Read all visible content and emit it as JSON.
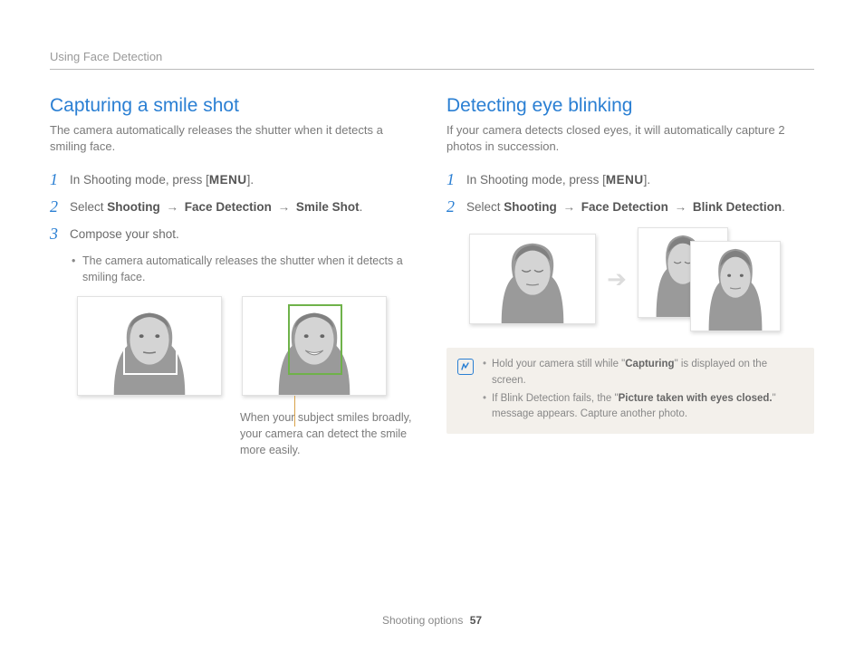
{
  "breadcrumb": "Using Face Detection",
  "left": {
    "title": "Capturing a smile shot",
    "intro": "The camera automatically releases the shutter when it detects a smiling face.",
    "steps": {
      "s1_pre": "In Shooting mode, press [",
      "s1_menu": "MENU",
      "s1_post": "].",
      "s2_pre": "Select ",
      "s2_a": "Shooting",
      "s2_b": "Face Detection",
      "s2_c": "Smile Shot",
      "s3": "Compose your shot."
    },
    "sub_bullet": "The camera automatically releases the shutter when it detects a smiling face.",
    "caption": "When your subject smiles broadly, your camera can detect the smile more easily."
  },
  "right": {
    "title": "Detecting eye blinking",
    "intro": "If your camera detects closed eyes, it will automatically capture 2 photos in succession.",
    "steps": {
      "s1_pre": "In Shooting mode, press [",
      "s1_menu": "MENU",
      "s1_post": "].",
      "s2_pre": "Select ",
      "s2_a": "Shooting",
      "s2_b": "Face Detection",
      "s2_c": "Blink Detection"
    },
    "note1_pre": "Hold your camera still while \"",
    "note1_bold": "Capturing",
    "note1_post": "\" is displayed on the screen.",
    "note2_pre": "If Blink Detection fails, the \"",
    "note2_bold": "Picture taken with eyes closed.",
    "note2_post": "\" message appears. Capture another photo."
  },
  "arrow": "→",
  "footer_section": "Shooting options",
  "footer_page": "57"
}
